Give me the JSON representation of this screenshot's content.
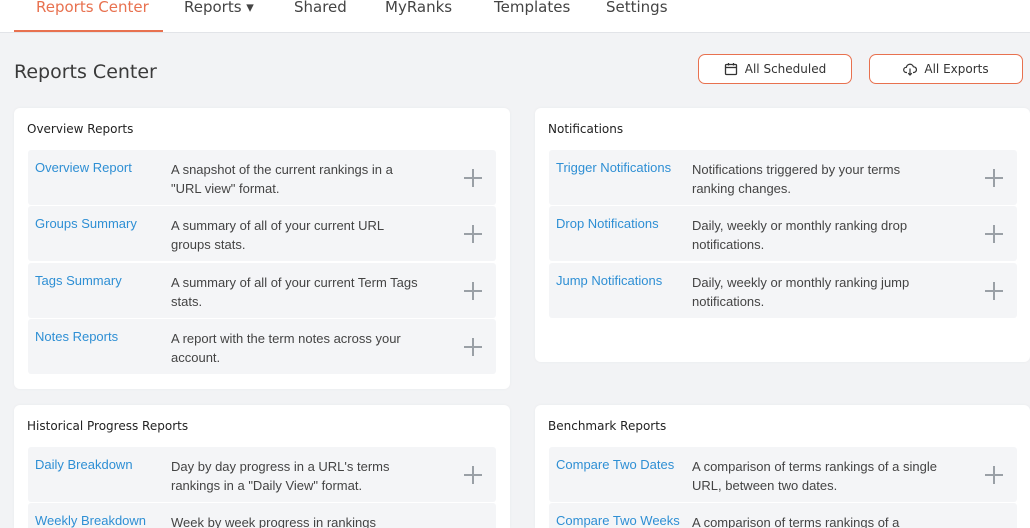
{
  "nav": {
    "tabs": [
      {
        "label": "Reports Center"
      },
      {
        "label": "Reports ▾"
      },
      {
        "label": "Shared"
      },
      {
        "label": "MyRanks"
      },
      {
        "label": "Templates"
      },
      {
        "label": "Settings"
      }
    ],
    "active_color": "#e8714f"
  },
  "header": {
    "title": "Reports Center",
    "buttons": {
      "scheduled": {
        "label": "All Scheduled",
        "icon": "calendar-icon"
      },
      "exports": {
        "label": "All Exports",
        "icon": "cloud-download-icon"
      }
    }
  },
  "cards": {
    "overview": {
      "title": "Overview Reports",
      "rows": [
        {
          "name": "Overview Report",
          "desc": "A snapshot of the current rankings in a \"URL view\" format."
        },
        {
          "name": "Groups Summary",
          "desc": "A summary of all of your current URL groups stats."
        },
        {
          "name": "Tags Summary",
          "desc": "A summary of all of your current Term Tags stats."
        },
        {
          "name": "Notes Reports",
          "desc": "A report with the term notes across your account."
        }
      ]
    },
    "notifications": {
      "title": "Notifications",
      "rows": [
        {
          "name": "Trigger Notifications",
          "desc": "Notifications triggered by your terms ranking changes."
        },
        {
          "name": "Drop Notifications",
          "desc": "Daily, weekly or monthly ranking drop notifications."
        },
        {
          "name": "Jump Notifications",
          "desc": "Daily, weekly or monthly ranking jump notifications."
        }
      ]
    },
    "historical": {
      "title": "Historical Progress Reports",
      "rows": [
        {
          "name": "Daily Breakdown",
          "desc": "Day by day progress in a URL's terms rankings in a \"Daily View\" format."
        },
        {
          "name": "Weekly Breakdown",
          "desc": "Week by week progress in rankings"
        }
      ]
    },
    "benchmark": {
      "title": "Benchmark Reports",
      "rows": [
        {
          "name": "Compare Two Dates",
          "desc": "A comparison of terms rankings of a single URL, between two dates."
        },
        {
          "name": "Compare Two Weeks",
          "desc": "A comparison of terms rankings of a"
        }
      ]
    }
  }
}
